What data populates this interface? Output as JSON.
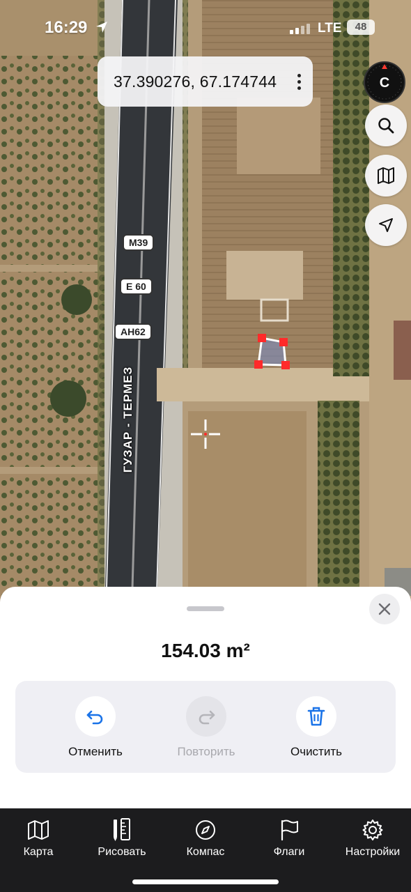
{
  "status_bar": {
    "time": "16:29",
    "network": "LTE",
    "battery": "48"
  },
  "map": {
    "coordinates": "37.390276, 67.174744",
    "compass_letter": "С",
    "road_shields": [
      "M39",
      "E 60",
      "AH62"
    ],
    "road_name": "ГУЗАР - ТЕРМЕЗ",
    "side_buttons": [
      "search-icon",
      "map-icon",
      "location-arrow-icon"
    ]
  },
  "sheet": {
    "area": "154.03 m²",
    "actions": [
      {
        "label": "Отменить",
        "icon": "undo-icon",
        "enabled": true
      },
      {
        "label": "Повторить",
        "icon": "redo-icon",
        "enabled": false
      },
      {
        "label": "Очистить",
        "icon": "trash-icon",
        "enabled": true
      }
    ]
  },
  "tabs": [
    {
      "label": "Карта",
      "icon": "map-icon"
    },
    {
      "label": "Рисовать",
      "icon": "ruler-pencil-icon"
    },
    {
      "label": "Компас",
      "icon": "compass-icon"
    },
    {
      "label": "Флаги",
      "icon": "flag-icon"
    },
    {
      "label": "Настройки",
      "icon": "gear-icon"
    }
  ],
  "colors": {
    "accent": "#1a73e8",
    "polygon_vertex": "#ff2a2a",
    "tab_bar": "#1c1c1e"
  }
}
